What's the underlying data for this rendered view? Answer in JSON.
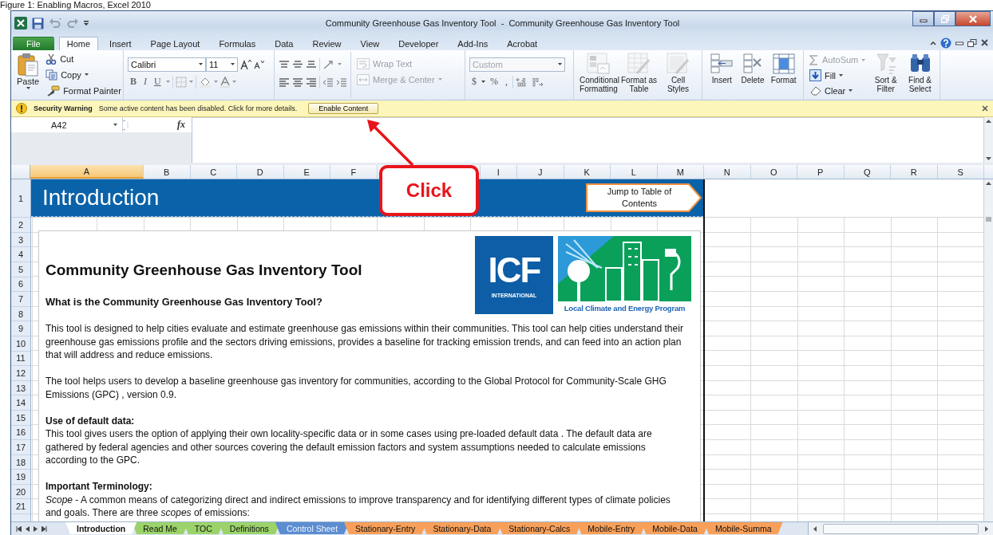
{
  "caption": "Figure 1: Enabling Macros, Excel 2010",
  "window": {
    "title": "Community Greenhouse Gas Inventory Tool  -  Community Greenhouse Gas Inventory Tool"
  },
  "ribbon_tabs": [
    {
      "label": "File",
      "kind": "backstage",
      "selected": false
    },
    {
      "label": "Home",
      "kind": "tab",
      "selected": true
    },
    {
      "label": "Insert",
      "kind": "tab",
      "selected": false
    },
    {
      "label": "Page Layout",
      "kind": "tab",
      "selected": false
    },
    {
      "label": "Formulas",
      "kind": "tab",
      "selected": false
    },
    {
      "label": "Data",
      "kind": "tab",
      "selected": false
    },
    {
      "label": "Review",
      "kind": "tab",
      "selected": false
    },
    {
      "label": "View",
      "kind": "tab",
      "selected": false
    },
    {
      "label": "Developer",
      "kind": "tab",
      "selected": false
    },
    {
      "label": "Add-Ins",
      "kind": "tab",
      "selected": false
    },
    {
      "label": "Acrobat",
      "kind": "tab",
      "selected": false
    }
  ],
  "clipboard": {
    "paste": "Paste",
    "tools": [
      {
        "label": "Cut",
        "kind": "cut",
        "dropdown": false
      },
      {
        "label": "Copy",
        "kind": "copy",
        "dropdown": true
      },
      {
        "label": "Format Painter",
        "kind": "painter",
        "dropdown": false
      }
    ]
  },
  "font": {
    "name": "Calibri",
    "size": "11",
    "styles": [
      "B",
      "I",
      "U"
    ]
  },
  "alignment": {
    "tools": [
      {
        "label": "Wrap Text",
        "kind": "wrap",
        "disabled": true
      },
      {
        "label": "Merge & Center",
        "kind": "merge",
        "disabled": true
      }
    ]
  },
  "number": {
    "format": "Custom",
    "disabled": true,
    "symbols": [
      "$",
      "%",
      ","
    ]
  },
  "large_buttons": [
    {
      "label": "Conditional Formatting",
      "kind": "conditional",
      "disabled": true
    },
    {
      "label": "Format as Table",
      "kind": "table",
      "disabled": true
    },
    {
      "label": "Cell Styles",
      "kind": "styles",
      "disabled": true
    },
    {
      "label": "Insert",
      "kind": "insert",
      "disabled": false
    },
    {
      "label": "Delete",
      "kind": "delete",
      "disabled": false
    },
    {
      "label": "Format",
      "kind": "format",
      "disabled": false
    }
  ],
  "editing": {
    "tools": [
      {
        "label": "AutoSum",
        "kind": "sum",
        "disabled": true
      },
      {
        "label": "Fill",
        "kind": "fill",
        "disabled": false
      },
      {
        "label": "Clear",
        "kind": "clear",
        "disabled": false
      }
    ],
    "large": [
      {
        "label": "Sort & Filter",
        "kind": "sort",
        "disabled": true
      },
      {
        "label": "Find & Select",
        "kind": "find",
        "disabled": false
      }
    ]
  },
  "security_bar": {
    "title": "Security Warning",
    "message": "Some active content has been disabled. Click for more details.",
    "button": "Enable Content"
  },
  "formula_bar": {
    "name_box": "A42",
    "function_label": "fx"
  },
  "columns": {
    "before_callout": [
      {
        "label": "A",
        "selected": true
      },
      {
        "label": "B",
        "selected": false
      },
      {
        "label": "C",
        "selected": false
      },
      {
        "label": "D",
        "selected": false
      },
      {
        "label": "E",
        "selected": false
      },
      {
        "label": "F",
        "selected": false
      }
    ],
    "after_callout": [
      {
        "label": "I",
        "selected": false
      },
      {
        "label": "J",
        "selected": false
      },
      {
        "label": "K",
        "selected": false
      },
      {
        "label": "L",
        "selected": false
      },
      {
        "label": "M",
        "selected": false
      },
      {
        "label": "N",
        "selected": false
      },
      {
        "label": "O",
        "selected": false
      },
      {
        "label": "P",
        "selected": false
      },
      {
        "label": "Q",
        "selected": false
      },
      {
        "label": "R",
        "selected": false
      },
      {
        "label": "S",
        "selected": false
      }
    ]
  },
  "rows": [
    "1",
    "2",
    "3",
    "4",
    "5",
    "6",
    "7",
    "8",
    "9",
    "10",
    "11",
    "12",
    "13",
    "14",
    "15",
    "16",
    "17",
    "18",
    "19",
    "20",
    "21"
  ],
  "sheet": {
    "banner_title": "Introduction",
    "toc_link": "Jump to Table of Contents",
    "heading": "Community Greenhouse Gas Inventory Tool",
    "logo": {
      "brand": "ICF",
      "brand_sub": "INTERNATIONAL",
      "program": "Local Climate and Energy Program"
    },
    "blocks": [
      {
        "kind": "subheading",
        "text": "What is the Community Greenhouse Gas Inventory Tool?"
      },
      {
        "kind": "paragraph",
        "text": "This tool is designed to help cities evaluate and estimate greenhouse gas emissions within their communities. This tool can help cities understand their greenhouse gas emissions profile and the sectors driving emissions, provides a baseline for tracking emission trends, and can feed into an action plan that will address and reduce emissions."
      },
      {
        "kind": "paragraph",
        "text": "The tool helps users to develop a baseline greenhouse gas inventory for communities,  according to the Global Protocol for Community-Scale  GHG Emissions (GPC) , version 0.9."
      },
      {
        "kind": "label",
        "text": "Use of default data:"
      },
      {
        "kind": "paragraph",
        "text": "This tool gives users the option of applying their own locality-specific data or in some cases using pre-loaded default data . The default data are gathered by federal agencies and other sources covering the default emission factors and system assumptions needed to calculate emissions according to the GPC."
      },
      {
        "kind": "label",
        "text": "Important Terminology:"
      },
      {
        "kind": "paragraph",
        "text": "*Scope* - A common means of categorizing direct and indirect emissions to improve transparency and for identifying different types of climate policies and goals. There are three *scopes* of emissions:"
      }
    ]
  },
  "callout": {
    "label": "Click"
  },
  "sheet_tabs": [
    {
      "label": "Introduction",
      "selected": true,
      "color": "#ffffff"
    },
    {
      "label": "Read Me",
      "selected": false,
      "color": "#9bd36a"
    },
    {
      "label": "TOC",
      "selected": false,
      "color": "#9bd36a"
    },
    {
      "label": "Definitions",
      "selected": false,
      "color": "#9bd36a"
    },
    {
      "label": "Control Sheet",
      "selected": false,
      "color": "#5b8dd0"
    },
    {
      "label": "Stationary-Entry",
      "selected": false,
      "color": "#f8a05a"
    },
    {
      "label": "Stationary-Data",
      "selected": false,
      "color": "#f8a05a"
    },
    {
      "label": "Stationary-Calcs",
      "selected": false,
      "color": "#f8a05a"
    },
    {
      "label": "Mobile-Entry",
      "selected": false,
      "color": "#f8a05a"
    },
    {
      "label": "Mobile-Data",
      "selected": false,
      "color": "#f8a05a"
    },
    {
      "label": "Mobile-Summa",
      "selected": false,
      "color": "#f8a05a"
    }
  ]
}
